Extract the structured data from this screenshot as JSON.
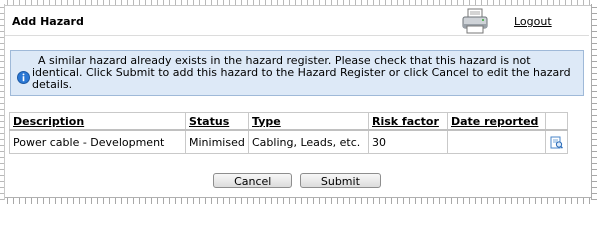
{
  "header": {
    "title": "Add Hazard",
    "logout_label": "Logout"
  },
  "notice": {
    "icon": "info-icon",
    "line1": "A similar hazard already exists in the hazard register. Please check that this hazard is not",
    "line2": "identical. Click Submit to add this hazard to the Hazard Register or click Cancel to edit the hazard",
    "line3": "details."
  },
  "table": {
    "headers": {
      "description": "Description",
      "status": "Status",
      "type": "Type",
      "risk": "Risk factor",
      "date": "Date reported"
    },
    "rows": [
      {
        "description": "Power cable - Development",
        "status": "Minimised",
        "type": "Cabling, Leads, etc.",
        "risk": "30",
        "date": "",
        "action_icon": "view-details-icon"
      }
    ]
  },
  "buttons": {
    "cancel": "Cancel",
    "submit": "Submit"
  },
  "colors": {
    "info_background": "#dde9f7",
    "info_border": "#9fb9d8",
    "info_icon": "#2a77d4"
  }
}
